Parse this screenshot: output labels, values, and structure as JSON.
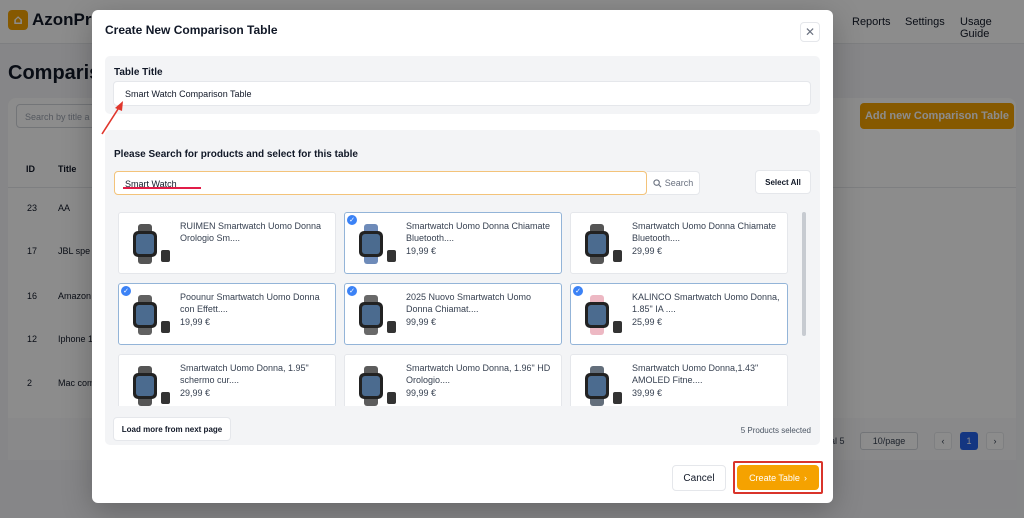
{
  "app": {
    "logo_text": "AzonPre",
    "nav": [
      "Reports",
      "Settings",
      "Usage Guide"
    ],
    "page_title": "Compariso",
    "search_placeholder": "Search by title a",
    "add_button": "Add new Comparison Table",
    "columns": [
      "ID",
      "Title"
    ],
    "rows": [
      {
        "id": "23",
        "title": "AA"
      },
      {
        "id": "17",
        "title": "JBL spe"
      },
      {
        "id": "16",
        "title": "Amazon"
      },
      {
        "id": "12",
        "title": "Iphone 1"
      },
      {
        "id": "2",
        "title": "Mac com"
      }
    ],
    "pagination": {
      "total_text": "al 5",
      "per_page": "10/page",
      "prev": "‹",
      "current": "1",
      "next": "›"
    }
  },
  "modal": {
    "title": "Create New Comparison Table",
    "close_icon": "close-icon",
    "table_title_label": "Table Title",
    "table_title_value": "Smart Watch Comparison Table",
    "products_label": "Please Search for products and select for this table",
    "search_value": "Smart Watch",
    "search_button": "Search",
    "select_all": "Select All",
    "products": [
      {
        "name": "RUIMEN Smartwatch Uomo Donna Orologio Sm....",
        "price": "",
        "selected": false,
        "color": "#2b2b2b"
      },
      {
        "name": "Smartwatch Uomo Donna Chiamate Bluetooth....",
        "price": "19,99 €",
        "selected": true,
        "color": "#4a6ea8"
      },
      {
        "name": "Smartwatch Uomo Donna Chiamate Bluetooth....",
        "price": "29,99 €",
        "selected": false,
        "color": "#2b2b2b"
      },
      {
        "name": "Poounur Smartwatch Uomo Donna con Effett....",
        "price": "19,99 €",
        "selected": true,
        "color": "#3a3a3a"
      },
      {
        "name": "2025 Nuovo Smartwatch Uomo Donna Chiamat....",
        "price": "99,99 €",
        "selected": true,
        "color": "#444"
      },
      {
        "name": "KALINCO Smartwatch Uomo Donna, 1.85\" IA ....",
        "price": "25,99 €",
        "selected": true,
        "color": "#e8a6b4"
      },
      {
        "name": "Smartwatch Uomo Donna, 1.95\" schermo cur....",
        "price": "29,99 €",
        "selected": false,
        "color": "#2b2b2b"
      },
      {
        "name": "Smartwatch Uomo Donna, 1.96\" HD Orologio....",
        "price": "99,99 €",
        "selected": false,
        "color": "#333"
      },
      {
        "name": "Smartwatch Uomo Donna,1.43\" AMOLED Fitne....",
        "price": "39,99 €",
        "selected": false,
        "color": "#3c4a5a"
      }
    ],
    "load_more": "Load more from next page",
    "selected_count": "5 Products selected",
    "cancel": "Cancel",
    "create": "Create Table",
    "create_icon": "chevron-right-icon"
  },
  "colors": {
    "accent": "#f5a200",
    "highlight": "#d9342b",
    "check": "#3b82f6"
  }
}
